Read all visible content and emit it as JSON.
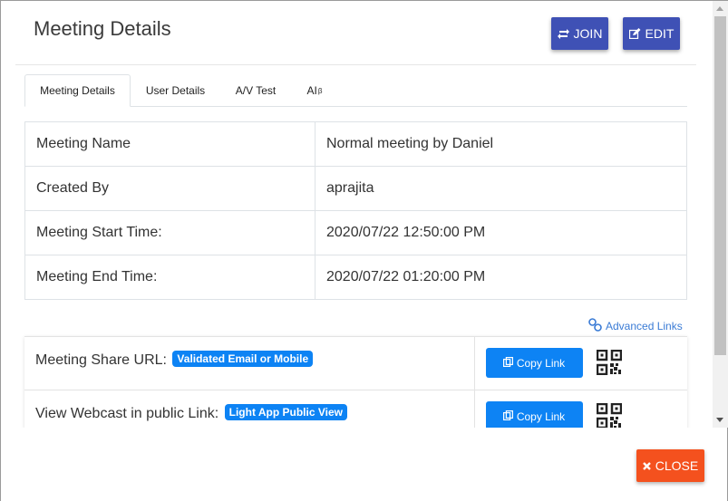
{
  "modal": {
    "title": "Meeting Details",
    "join_label": "JOIN",
    "edit_label": "EDIT",
    "close_label": "CLOSE"
  },
  "tabs": [
    {
      "label": "Meeting Details",
      "active": true
    },
    {
      "label": "User Details",
      "active": false
    },
    {
      "label": "A/V Test",
      "active": false
    },
    {
      "label": "AI",
      "sup": "β",
      "active": false
    }
  ],
  "details": [
    {
      "key": "Meeting Name",
      "value": "Normal meeting by Daniel"
    },
    {
      "key": "Created By",
      "value": "aprajita"
    },
    {
      "key": "Meeting Start Time:",
      "value": "2020/07/22 12:50:00 PM"
    },
    {
      "key": "Meeting End Time:",
      "value": "2020/07/22 01:20:00 PM"
    }
  ],
  "advanced_links_label": "Advanced Links",
  "links": [
    {
      "label": "Meeting Share URL:",
      "badge": "Validated Email or Mobile",
      "copy_label": "Copy Link"
    },
    {
      "label": "View Webcast in public Link:",
      "badge": "Light App Public View",
      "copy_label": "Copy Link"
    }
  ],
  "colors": {
    "primary": "#3f51b5",
    "link_blue": "#0d83f4",
    "close_orange": "#f4511e"
  },
  "icons": {
    "join": "refresh-icon",
    "edit": "edit-icon",
    "advanced_links": "link-icon",
    "copy": "copy-icon",
    "qr": "qr-code-icon",
    "close": "close-icon"
  }
}
